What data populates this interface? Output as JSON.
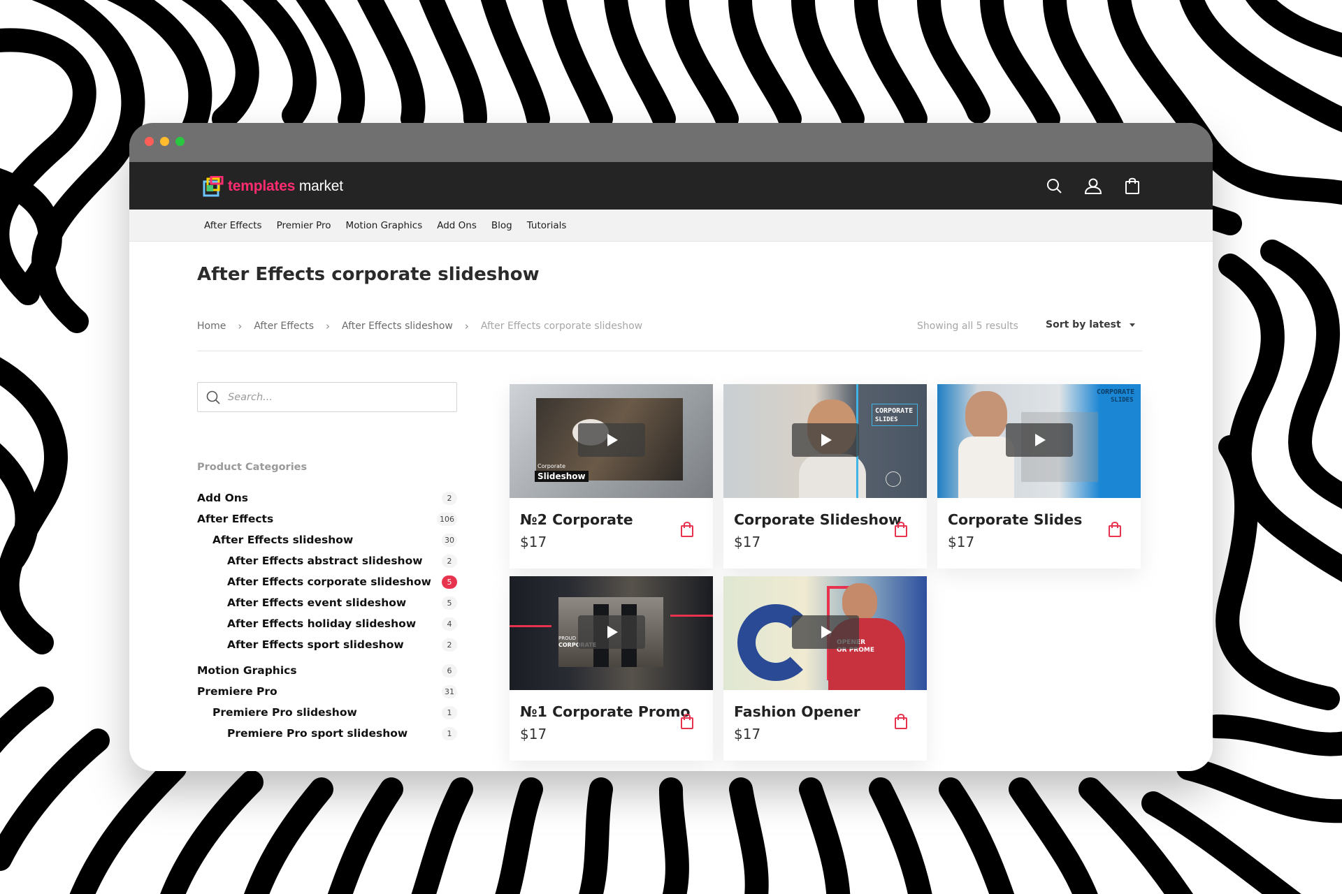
{
  "browser": {
    "dots": [
      "#ff5f57",
      "#ffbd2e",
      "#28c840"
    ]
  },
  "site": {
    "logo_bold": "templates",
    "logo_rest": " market",
    "brand_color": "#ff2d6f"
  },
  "header_icons": [
    "search-icon",
    "user-icon",
    "bag-icon"
  ],
  "nav": [
    "After Effects",
    "Premier Pro",
    "Motion Graphics",
    "Add Ons",
    "Blog",
    "Tutorials"
  ],
  "page": {
    "title": "After Effects corporate slideshow",
    "breadcrumb": [
      "Home",
      "After Effects",
      "After Effects slideshow",
      "After Effects corporate slideshow"
    ],
    "breadcrumb_sep": "›",
    "result_count": "Showing all 5 results",
    "sort_label": "Sort by latest"
  },
  "sidebar": {
    "search_placeholder": "Search...",
    "categories_heading": "Product Categories",
    "categories": [
      {
        "label": "Add Ons",
        "count": "2",
        "level": 0
      },
      {
        "label": "After Effects",
        "count": "106",
        "level": 0
      },
      {
        "label": "After Effects slideshow",
        "count": "30",
        "level": 1
      },
      {
        "label": "After Effects abstract slideshow",
        "count": "2",
        "level": 2
      },
      {
        "label": "After Effects corporate slideshow",
        "count": "5",
        "level": 2,
        "active": true
      },
      {
        "label": "After Effects event slideshow",
        "count": "5",
        "level": 2
      },
      {
        "label": "After Effects holiday slideshow",
        "count": "4",
        "level": 2
      },
      {
        "label": "After Effects sport slideshow",
        "count": "2",
        "level": 2
      },
      {
        "label": "Motion Graphics",
        "count": "6",
        "level": 0
      },
      {
        "label": "Premiere Pro",
        "count": "31",
        "level": 0
      },
      {
        "label": "Premiere Pro slideshow",
        "count": "1",
        "level": 1
      },
      {
        "label": "Premiere Pro sport slideshow",
        "count": "1",
        "level": 2
      }
    ]
  },
  "products": [
    {
      "title": "№2 Corporate",
      "price": "$17",
      "thumb_text": [
        "Corporate",
        "Slideshow"
      ]
    },
    {
      "title": "Corporate Slideshow",
      "price": "$17",
      "thumb_text": [
        "CORPORATE",
        "SLIDES"
      ]
    },
    {
      "title": "Corporate Slides",
      "price": "$17",
      "thumb_text": [
        "CORPORATE",
        "SLIDES"
      ]
    },
    {
      "title": "№1 Corporate Promo",
      "price": "$17",
      "thumb_text": [
        "PROUD",
        "CORPORATE"
      ]
    },
    {
      "title": "Fashion Opener",
      "price": "$17",
      "thumb_text": [
        "OPENER",
        "OR PROME"
      ]
    }
  ],
  "colors": {
    "accent": "#e8334f",
    "header_bg": "#242424"
  }
}
